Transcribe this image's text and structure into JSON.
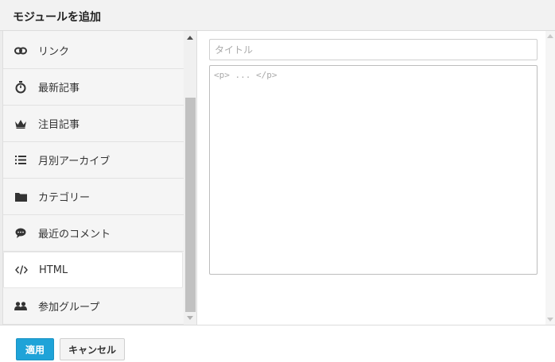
{
  "dialog": {
    "title": "モジュールを追加"
  },
  "sidebar": {
    "items": [
      {
        "label": "リンク",
        "icon": "link-icon"
      },
      {
        "label": "最新記事",
        "icon": "stopwatch-icon"
      },
      {
        "label": "注目記事",
        "icon": "crown-icon"
      },
      {
        "label": "月別アーカイブ",
        "icon": "list-icon"
      },
      {
        "label": "カテゴリー",
        "icon": "folder-icon"
      },
      {
        "label": "最近のコメント",
        "icon": "comment-icon"
      },
      {
        "label": "HTML",
        "icon": "code-icon",
        "active": true
      },
      {
        "label": "参加グループ",
        "icon": "users-icon"
      }
    ]
  },
  "form": {
    "title_placeholder": "タイトル",
    "html_placeholder": "<p> ... </p>"
  },
  "footer": {
    "apply_label": "適用",
    "cancel_label": "キャンセル"
  },
  "colors": {
    "accent": "#1fa3d8",
    "header_bg": "#f2f2f2",
    "sidebar_bg": "#f5f5f5"
  }
}
